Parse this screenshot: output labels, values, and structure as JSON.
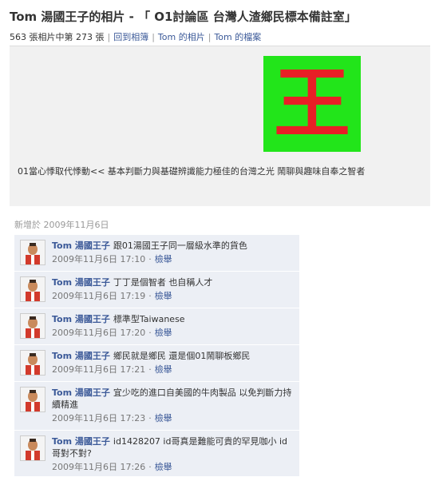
{
  "header": {
    "title": "Tom 湯國王子的相片 - 「 O1討論區 台灣人渣鄉民標本備註室」"
  },
  "subnav": {
    "count_text": "563 張相片中第 273 張",
    "links": [
      "回到相簿",
      "Tom 的相片",
      "Tom 的檔案"
    ]
  },
  "photo": {
    "glyph": "王",
    "background": "#22e51a",
    "glyph_color": "#e81f26",
    "caption": "01當心悸取代悸動<< 基本判斷力與基礎辨識能力極佳的台灣之光 鬧聊與趣味自奉之智者"
  },
  "added_text": "新增於 2009年11月6日",
  "comments": [
    {
      "author": "Tom 湯國王子",
      "text": "跟01湯國王子同一層級水準的貨色",
      "time": "2009年11月6日 17:10",
      "action": "檢舉"
    },
    {
      "author": "Tom 湯國王子",
      "text": "丁丁是個智者 也自稱人才",
      "time": "2009年11月6日 17:19",
      "action": "檢舉"
    },
    {
      "author": "Tom 湯國王子",
      "text": "標準型Taiwanese",
      "time": "2009年11月6日 17:20",
      "action": "檢舉"
    },
    {
      "author": "Tom 湯國王子",
      "text": "鄉民就是鄉民 還是個01鬧聊板鄉民",
      "time": "2009年11月6日 17:21",
      "action": "檢舉"
    },
    {
      "author": "Tom 湯國王子",
      "text": "宜少吃的進口自美國的牛肉製品 以免判斷力持續精進",
      "time": "2009年11月6日 17:23",
      "action": "檢舉"
    },
    {
      "author": "Tom 湯國王子",
      "text": "id1428207 id哥真是難能可貴的罕見咖小 id哥對不對?",
      "time": "2009年11月6日 17:26",
      "action": "檢舉"
    }
  ]
}
